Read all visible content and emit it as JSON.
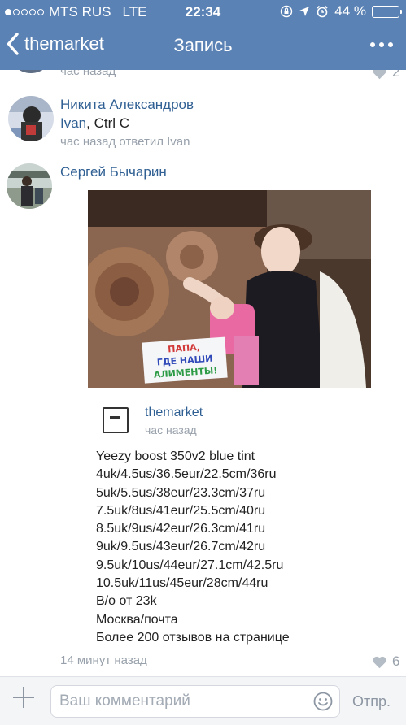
{
  "status_bar": {
    "carrier": "MTS RUS",
    "network": "LTE",
    "time": "22:34",
    "battery": "44 %",
    "battery_level": 0.44
  },
  "nav": {
    "back_label": "themarket",
    "title": "Запись"
  },
  "comments": [
    {
      "meta": "час назад",
      "likes": "2"
    },
    {
      "author": "Никита Александров",
      "mention": "Ivan",
      "text": ", Ctrl C",
      "meta": "час назад ответил Ivan"
    },
    {
      "author": "Сергей Бычарин",
      "photo_sign": [
        "ПАПА,",
        "ГДЕ НАШИ",
        "АЛИМЕНТЫ!"
      ],
      "repost": {
        "source": "themarket",
        "time": "час назад",
        "lines": [
          "Yeezy boost 350v2 blue tint",
          "4uk/4.5us/36.5eur/22.5cm/36ru",
          "5uk/5.5us/38eur/23.3cm/37ru",
          "7.5uk/8us/41eur/25.5cm/40ru",
          "8.5uk/9us/42eur/26.3cm/41ru",
          "9uk/9.5us/43eur/26.7cm/42ru",
          "9.5uk/10us/44eur/27.1cm/42.5ru",
          "10.5uk/11us/45eur/28cm/44ru",
          "В/о от 23k",
          "Москва/почта",
          "Более 200 отзывов на странице"
        ]
      },
      "meta": "14 минут назад",
      "likes": "6"
    }
  ],
  "composer": {
    "placeholder": "Ваш комментарий",
    "send_label": "Отпр."
  },
  "colors": {
    "header": "#5b82b4",
    "link": "#2f5f93",
    "meta": "#98a1ab"
  },
  "icons": [
    "back-chevron-icon",
    "more-icon",
    "like-heart-icon",
    "plus-icon",
    "emoji-icon",
    "repost-source-icon",
    "alarm-icon",
    "location-icon",
    "rotation-lock-icon"
  ]
}
